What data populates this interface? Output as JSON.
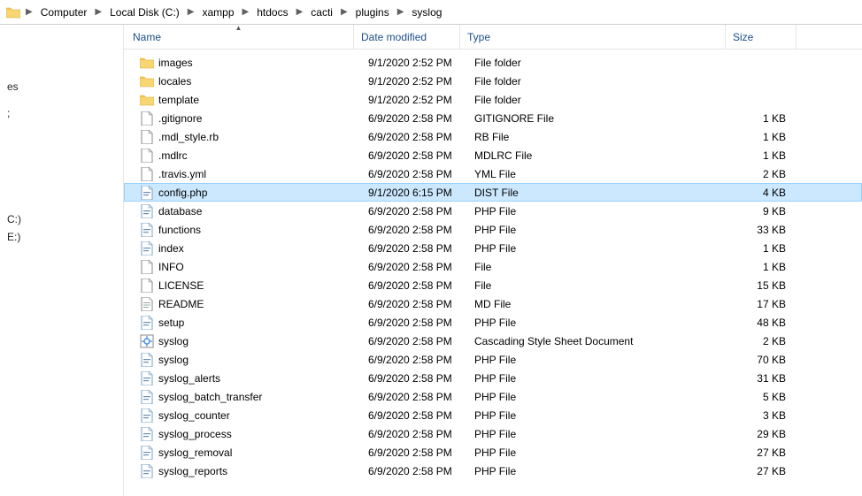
{
  "breadcrumb": [
    "Computer",
    "Local Disk (C:)",
    "xampp",
    "htdocs",
    "cacti",
    "plugins",
    "syslog"
  ],
  "sidebar": {
    "items": [
      "es",
      "",
      ";",
      "",
      "",
      "",
      "",
      "",
      "",
      "",
      "",
      "",
      "C:)",
      "E:)"
    ]
  },
  "columns": {
    "name": "Name",
    "date": "Date modified",
    "type": "Type",
    "size": "Size"
  },
  "files": [
    {
      "icon": "folder",
      "name": "images",
      "date": "9/1/2020 2:52 PM",
      "type": "File folder",
      "size": ""
    },
    {
      "icon": "folder",
      "name": "locales",
      "date": "9/1/2020 2:52 PM",
      "type": "File folder",
      "size": ""
    },
    {
      "icon": "folder",
      "name": "template",
      "date": "9/1/2020 2:52 PM",
      "type": "File folder",
      "size": ""
    },
    {
      "icon": "file",
      "name": ".gitignore",
      "date": "6/9/2020 2:58 PM",
      "type": "GITIGNORE File",
      "size": "1 KB"
    },
    {
      "icon": "file",
      "name": ".mdl_style.rb",
      "date": "6/9/2020 2:58 PM",
      "type": "RB File",
      "size": "1 KB"
    },
    {
      "icon": "file",
      "name": ".mdlrc",
      "date": "6/9/2020 2:58 PM",
      "type": "MDLRC File",
      "size": "1 KB"
    },
    {
      "icon": "file",
      "name": ".travis.yml",
      "date": "6/9/2020 2:58 PM",
      "type": "YML File",
      "size": "2 KB"
    },
    {
      "icon": "php",
      "name": "config.php",
      "date": "9/1/2020 6:15 PM",
      "type": "DIST File",
      "size": "4 KB",
      "selected": true
    },
    {
      "icon": "php",
      "name": "database",
      "date": "6/9/2020 2:58 PM",
      "type": "PHP File",
      "size": "9 KB"
    },
    {
      "icon": "php",
      "name": "functions",
      "date": "6/9/2020 2:58 PM",
      "type": "PHP File",
      "size": "33 KB"
    },
    {
      "icon": "php",
      "name": "index",
      "date": "6/9/2020 2:58 PM",
      "type": "PHP File",
      "size": "1 KB"
    },
    {
      "icon": "file",
      "name": "INFO",
      "date": "6/9/2020 2:58 PM",
      "type": "File",
      "size": "1 KB"
    },
    {
      "icon": "file",
      "name": "LICENSE",
      "date": "6/9/2020 2:58 PM",
      "type": "File",
      "size": "15 KB"
    },
    {
      "icon": "text",
      "name": "README",
      "date": "6/9/2020 2:58 PM",
      "type": "MD File",
      "size": "17 KB"
    },
    {
      "icon": "php",
      "name": "setup",
      "date": "6/9/2020 2:58 PM",
      "type": "PHP File",
      "size": "48 KB"
    },
    {
      "icon": "css",
      "name": "syslog",
      "date": "6/9/2020 2:58 PM",
      "type": "Cascading Style Sheet Document",
      "size": "2 KB"
    },
    {
      "icon": "php",
      "name": "syslog",
      "date": "6/9/2020 2:58 PM",
      "type": "PHP File",
      "size": "70 KB"
    },
    {
      "icon": "php",
      "name": "syslog_alerts",
      "date": "6/9/2020 2:58 PM",
      "type": "PHP File",
      "size": "31 KB"
    },
    {
      "icon": "php",
      "name": "syslog_batch_transfer",
      "date": "6/9/2020 2:58 PM",
      "type": "PHP File",
      "size": "5 KB"
    },
    {
      "icon": "php",
      "name": "syslog_counter",
      "date": "6/9/2020 2:58 PM",
      "type": "PHP File",
      "size": "3 KB"
    },
    {
      "icon": "php",
      "name": "syslog_process",
      "date": "6/9/2020 2:58 PM",
      "type": "PHP File",
      "size": "29 KB"
    },
    {
      "icon": "php",
      "name": "syslog_removal",
      "date": "6/9/2020 2:58 PM",
      "type": "PHP File",
      "size": "27 KB"
    },
    {
      "icon": "php",
      "name": "syslog_reports",
      "date": "6/9/2020 2:58 PM",
      "type": "PHP File",
      "size": "27 KB"
    }
  ]
}
